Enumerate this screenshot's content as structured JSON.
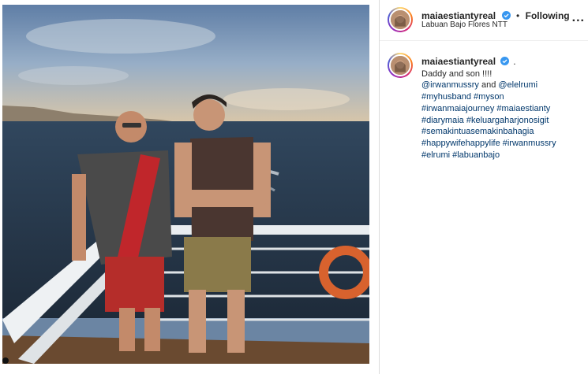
{
  "post": {
    "header": {
      "username": "maiaestiantyreal",
      "separator": "•",
      "follow_label": "Following",
      "location": "Labuan Bajo Flores NTT",
      "more_label": "..."
    },
    "caption": {
      "username": "maiaestiantyreal",
      "trailing": ".",
      "line1": "Daddy and son !!!!",
      "mention1": "@irwanmussry",
      "and_word": "and",
      "mention2": "@elelrumi",
      "hashtag_lines": [
        "#myhusband #myson",
        "#irwanmaiajourney #maiaestianty",
        "#diarymaia #keluargaharjonosigit",
        "#semakintuasemakinbahagia",
        "#happywifehappylife #irwanmussry",
        "#elrumi #labuanbajo"
      ]
    },
    "icons": {
      "verified": "verified-badge-icon",
      "more": "more-options-icon"
    },
    "colors": {
      "verified_blue": "#3897f0",
      "hashtag": "#00376b",
      "text": "#262626"
    }
  }
}
